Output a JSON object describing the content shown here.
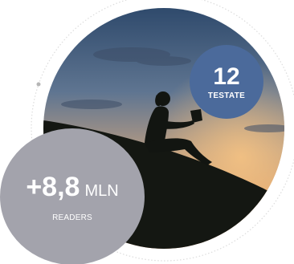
{
  "testate": {
    "value": "12",
    "label": "TESTATE",
    "color": "#4b6a9b"
  },
  "readers": {
    "value": "+8,8",
    "unit": "MLN",
    "label": "READERS",
    "color": "#a3a3ac"
  },
  "photo": {
    "subject": "silhouette-reading-on-hill-at-sunset"
  }
}
